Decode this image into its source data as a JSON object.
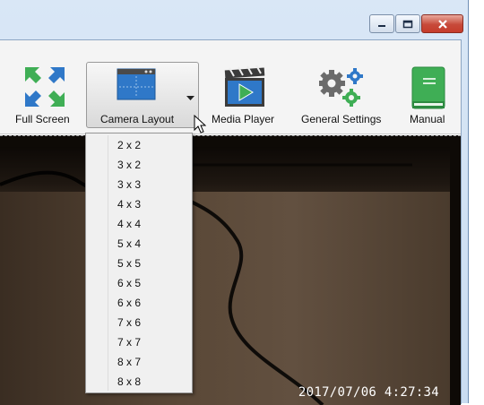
{
  "window": {
    "buttons": [
      "minimize",
      "maximize",
      "close"
    ]
  },
  "toolbar": {
    "full_screen": "Full Screen",
    "camera_layout": "Camera Layout",
    "media_player": "Media Player",
    "general_settings": "General Settings",
    "manual": "Manual"
  },
  "layout_menu": {
    "items": [
      "2 x 2",
      "3 x 2",
      "3 x 3",
      "4 x 3",
      "4 x 4",
      "5 x 4",
      "5 x 5",
      "6 x 5",
      "6 x 6",
      "7 x 6",
      "7 x 7",
      "8 x 7",
      "8 x 8"
    ]
  },
  "video": {
    "timestamp": "2017/07/06  4:27:34"
  },
  "colors": {
    "accent_blue": "#2f78c8",
    "green": "#3fae55",
    "gear_gray": "#6b6b6b"
  }
}
